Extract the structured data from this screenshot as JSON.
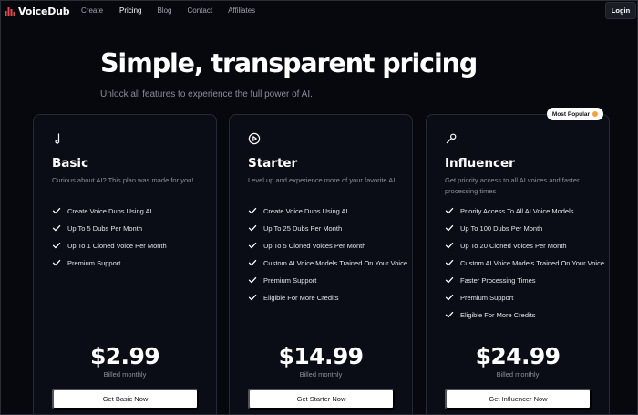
{
  "nav": {
    "brand": "VoiceDub",
    "links": [
      "Create",
      "Pricing",
      "Blog",
      "Contact",
      "Affiliates"
    ],
    "active": "Pricing",
    "login_label": "Login"
  },
  "hero": {
    "title": "Simple, transparent pricing",
    "subtitle": "Unlock all features to experience the full power of AI."
  },
  "badge": {
    "label": "Most Popular",
    "icon": "sparkle-icon"
  },
  "plans": [
    {
      "icon": "music-note-icon",
      "name": "Basic",
      "description": "Curious about AI? This plan was made for you!",
      "features": [
        "Create Voice Dubs Using AI",
        "Up To 5 Dubs Per Month",
        "Up To 1 Cloned Voice Per Month",
        "Premium Support"
      ],
      "price": "$2.99",
      "billing": "Billed monthly",
      "cta": "Get Basic Now"
    },
    {
      "icon": "play-circle-icon",
      "name": "Starter",
      "description": "Level up and experience more of your favorite AI",
      "features": [
        "Create Voice Dubs Using AI",
        "Up To 25 Dubs Per Month",
        "Up To 5 Cloned Voices Per Month",
        "Custom AI Voice Models Trained On Your Voice",
        "Premium Support",
        "Eligible For More Credits"
      ],
      "price": "$14.99",
      "billing": "Billed monthly",
      "cta": "Get Starter Now"
    },
    {
      "icon": "microphone-icon",
      "name": "Influencer",
      "description": "Get priority access to all AI voices and faster processing times",
      "features": [
        "Priority Access To All AI Voice Models",
        "Up To 100 Dubs Per Month",
        "Up To 20 Cloned Voices Per Month",
        "Custom AI Voice Models Trained On Your Voice",
        "Faster Processing Times",
        "Premium Support",
        "Eligible For More Credits"
      ],
      "price": "$24.99",
      "billing": "Billed monthly",
      "cta": "Get Influencer Now"
    }
  ],
  "colors": {
    "background": "#07080e",
    "card": "#0b0d16",
    "border": "#262935",
    "text_muted": "#8b8d99",
    "logo_red": "#e5484d",
    "badge_accent": "#f3a33a"
  }
}
